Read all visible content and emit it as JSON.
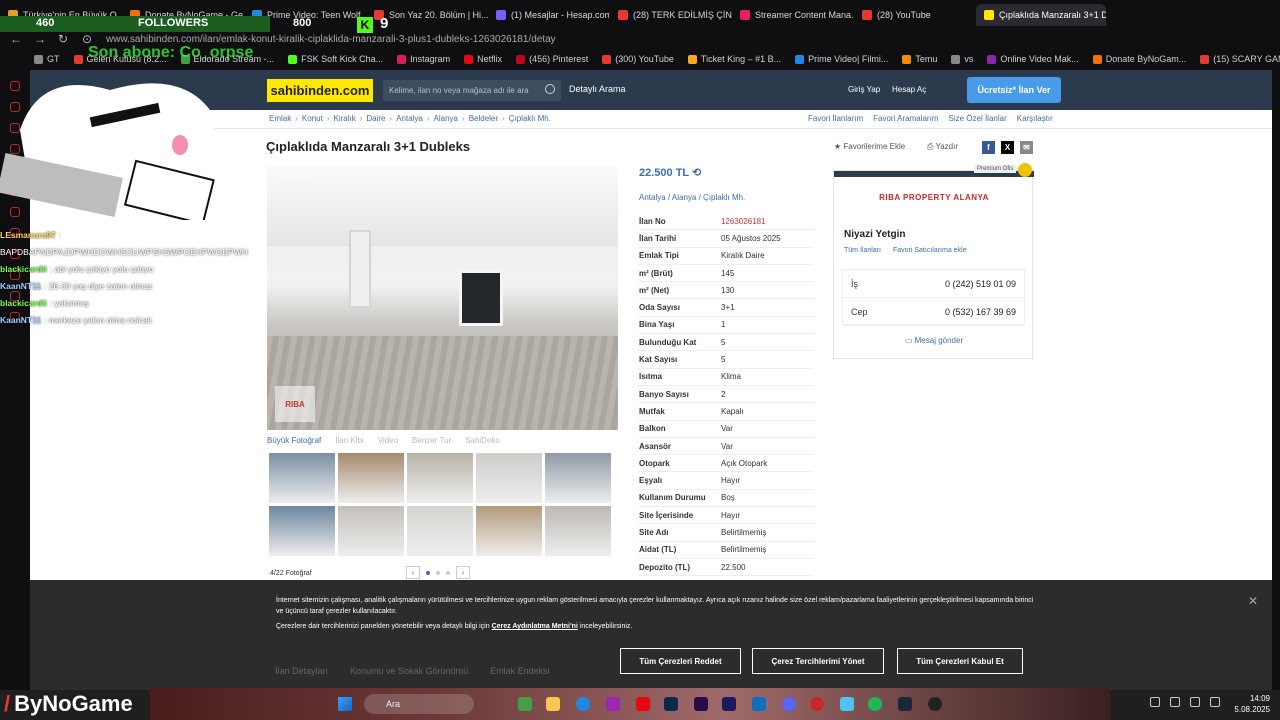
{
  "browser": {
    "tabs": [
      {
        "label": "Türkiye'nin En Büyük O...",
        "color": "#e0a020"
      },
      {
        "label": "Donate ByNoGame - Ge...",
        "color": "#f07000"
      },
      {
        "label": "Prime Video: Teen Wolf",
        "color": "#1e88e5"
      },
      {
        "label": "Son Yaz 20. Bölüm | Hi...",
        "color": "#e53935"
      },
      {
        "label": "(1) Mesajlar - Hesap.com",
        "color": "#7b5cff"
      },
      {
        "label": "(28) TERK EDİLMİŞ ÇİN...",
        "color": "#e53935"
      },
      {
        "label": "Streamer Content Mana...",
        "color": "#e91e63"
      },
      {
        "label": "(28) YouTube",
        "color": "#e53935"
      },
      {
        "label": "Çıplaklıda Manzaralı 3+1 D...",
        "color": "#ffe800",
        "active": true
      }
    ],
    "url": "www.sahibinden.com/ilan/emlak-konut-kiralik-ciplaklida-manzarali-3-plus1-dubleks-1263026181/detay",
    "bookmarks": [
      {
        "label": "GT",
        "color": "#888"
      },
      {
        "label": "Gelen Kutusu (8.2...",
        "color": "#e53935"
      },
      {
        "label": "Eldorado Stream -...",
        "color": "#43a047"
      },
      {
        "label": "FSK Soft Kick Cha...",
        "color": "#53fc18"
      },
      {
        "label": "Instagram",
        "color": "#d81b60"
      },
      {
        "label": "Netflix",
        "color": "#e50914"
      },
      {
        "label": "(456) Pinterest",
        "color": "#bd081c"
      },
      {
        "label": "(300) YouTube",
        "color": "#e53935"
      },
      {
        "label": "Ticket King – #1 B...",
        "color": "#f9a825"
      },
      {
        "label": "Prime Video| Filmi...",
        "color": "#1e88e5"
      },
      {
        "label": "Temu",
        "color": "#fb8c00"
      },
      {
        "label": "vs",
        "color": "#888"
      },
      {
        "label": "Online Video Mak...",
        "color": "#8e24aa"
      },
      {
        "label": "Donate ByNoGam...",
        "color": "#f07000"
      },
      {
        "label": "(15) SCARY GAME...",
        "color": "#e53935"
      }
    ]
  },
  "site": {
    "logo": "sahibinden.com",
    "search_placeholder": "Kelime, ilan no veya mağaza adı ile ara",
    "detailed_search": "Detaylı Arama",
    "login": "Giriş Yap",
    "account": "Hesap Aç",
    "post_ad": "Ücretsiz* İlan Ver",
    "breadcrumbs": [
      "Emlak",
      "Konut",
      "Kiralık",
      "Daire",
      "Antalya",
      "Alanya",
      "Beldeler",
      "Çıplaklı Mh."
    ],
    "right_links": [
      "Favori İlanlarım",
      "Favori Aramalarım",
      "Size Özel İlanlar",
      "Karşılaştır"
    ]
  },
  "listing": {
    "title": "Çıplaklıda Manzaralı 3+1 Dubleks",
    "add_favorite": "Favorilerime Ekle",
    "print": "Yazdır",
    "price": "22.500 TL",
    "location": "Antalya  /  Alanya  /  Çıplaklı Mh.",
    "photo_id": "#1263026181",
    "watermark": "RIBA",
    "photo_tabs": [
      "Büyük Fotoğraf",
      "İlan Kibi",
      "Video",
      "Benzer Tur",
      "SahiDeko"
    ],
    "photo_count": "4/22 Fotoğraf",
    "details": [
      {
        "k": "İlan No",
        "v": "1263026181",
        "red": true
      },
      {
        "k": "İlan Tarihi",
        "v": "05 Ağustos 2025"
      },
      {
        "k": "Emlak Tipi",
        "v": "Kiralık Daire"
      },
      {
        "k": "m² (Brüt)",
        "v": "145"
      },
      {
        "k": "m² (Net)",
        "v": "130"
      },
      {
        "k": "Oda Sayısı",
        "v": "3+1"
      },
      {
        "k": "Bina Yaşı",
        "v": "1"
      },
      {
        "k": "Bulunduğu Kat",
        "v": "5"
      },
      {
        "k": "Kat Sayısı",
        "v": "5"
      },
      {
        "k": "Isıtma",
        "v": "Klima"
      },
      {
        "k": "Banyo Sayısı",
        "v": "2"
      },
      {
        "k": "Mutfak",
        "v": "Kapalı"
      },
      {
        "k": "Balkon",
        "v": "Var"
      },
      {
        "k": "Asansör",
        "v": "Var"
      },
      {
        "k": "Otopark",
        "v": "Açık Otopark"
      },
      {
        "k": "Eşyalı",
        "v": "Hayır"
      },
      {
        "k": "Kullanım Durumu",
        "v": "Boş"
      },
      {
        "k": "Site İçerisinde",
        "v": "Hayır"
      },
      {
        "k": "Site Adı",
        "v": "Belirtilmemiş"
      },
      {
        "k": "Aidat (TL)",
        "v": "Belirtilmemiş"
      },
      {
        "k": "Depozito (TL)",
        "v": "22.500"
      }
    ]
  },
  "seller": {
    "premium": "Premium Ofis",
    "store": "RIBA PROPERTY ALANYA",
    "name": "Niyazi Yetgin",
    "all_ads": "Tüm İlanları",
    "add_fav_seller": "Favori Satıcılarıma ekle",
    "phones": [
      {
        "label": "İş",
        "number": "0 (242) 519 01 09"
      },
      {
        "label": "Cep",
        "number": "0 (532) 167 39 69"
      }
    ],
    "send_message": "Mesaj gönder"
  },
  "cookie": {
    "text1": "İnternet sitemizin çalışması, analitik çalışmaların yürütülmesi ve tercihlerinize uygun reklam gösterilmesi amacıyla çerezler kullanmaktayız. Ayrıca açık rızanız halinde size özel reklam/pazarlama faaliyetlerinin gerçekleştirilmesi kapsamında birinci ve üçüncü taraf çerezler kullanılacaktır.",
    "text2": "Çerezlere dair tercihlerinizi panelden yönetebilir veya detaylı bilgi için",
    "text2_link": "Çerez Aydınlatma Metni'ni",
    "text2_end": "inceleyebilirsiniz.",
    "reject": "Tüm Çerezleri Reddet",
    "manage": "Çerez Tercihlerimi Yönet",
    "accept": "Tüm Çerezleri Kabul Et",
    "bottom_tabs": [
      "İlan Detayları",
      "Konumu ve Sokak Görünümü",
      "Emlak Endeksi"
    ]
  },
  "overlay": {
    "followers_count": "460",
    "followers_label": "FOLLOWERS",
    "followers_goal": "800",
    "kick_count": "9",
    "last_sub": "Son abone: Co_orpse",
    "chat": [
      {
        "user": "LEsmanura97",
        "msg": ":",
        "cls": "y"
      },
      {
        "user": "",
        "msg": "BAPDBAPNDPAJDPWHDOWHSOUWPSHSWPOEHPWGEPWH",
        "cls": ""
      },
      {
        "user": "blackicardii",
        "msg": ": abi yolu çekiyo yolu çatıyo",
        "cls": ""
      },
      {
        "user": "KaanNT11",
        "msg": ": 26-30 yaş diye zaten olmaz",
        "cls": "b"
      },
      {
        "user": "blackicardii",
        "msg": ": yakınmış",
        "cls": ""
      },
      {
        "user": "KaanNT11",
        "msg": ": merkeze yakın olma nolcak",
        "cls": "b"
      }
    ],
    "brand": "ByNoGame"
  },
  "taskbar": {
    "search": "Ara",
    "time": "14:09",
    "date": "5.08.2025"
  }
}
